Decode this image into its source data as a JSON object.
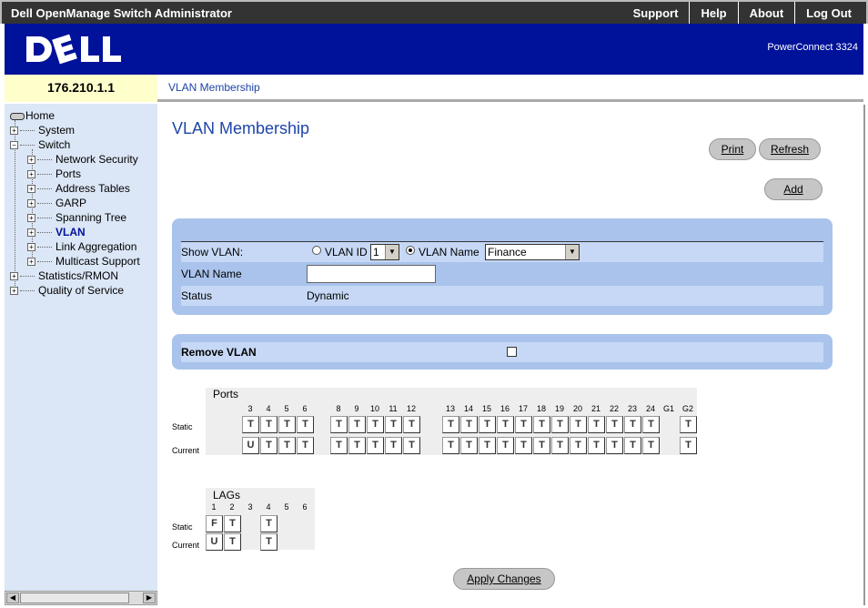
{
  "app": {
    "title": "Dell OpenManage Switch Administrator",
    "links": [
      "Support",
      "Help",
      "About",
      "Log Out"
    ],
    "model": "PowerConnect 3324",
    "ip": "176.210.1.1",
    "breadcrumb": "VLAN Membership"
  },
  "tree": {
    "home": "Home",
    "items": [
      {
        "label": "System",
        "level": 1
      },
      {
        "label": "Switch",
        "level": 1
      },
      {
        "label": "Network Security",
        "level": 2
      },
      {
        "label": "Ports",
        "level": 2
      },
      {
        "label": "Address Tables",
        "level": 2
      },
      {
        "label": "GARP",
        "level": 2
      },
      {
        "label": "Spanning Tree",
        "level": 2
      },
      {
        "label": "VLAN",
        "level": 2,
        "selected": true
      },
      {
        "label": "Link Aggregation",
        "level": 2
      },
      {
        "label": "Multicast Support",
        "level": 2
      },
      {
        "label": "Statistics/RMON",
        "level": 1
      },
      {
        "label": "Quality of Service",
        "level": 1
      }
    ]
  },
  "page": {
    "title": "VLAN Membership",
    "print_label": "Print",
    "refresh_label": "Refresh",
    "add_label": "Add",
    "apply_label": "Apply Changes"
  },
  "form": {
    "show_vlan_label": "Show VLAN:",
    "vlan_id_label": "VLAN ID",
    "vlan_id_value": "1",
    "vlan_name_radio_label": "VLAN Name",
    "vlan_name_select_value": "Finance",
    "vlan_name_label": "VLAN Name",
    "vlan_name_value": "",
    "status_label": "Status",
    "status_value": "Dynamic",
    "remove_vlan_label": "Remove VLAN",
    "remove_vlan_checked": false
  },
  "ports": {
    "title": "Ports",
    "static_label": "Static",
    "current_label": "Current",
    "numbers": [
      "3",
      "4",
      "5",
      "6",
      "8",
      "9",
      "10",
      "11",
      "12",
      "13",
      "14",
      "15",
      "16",
      "17",
      "18",
      "19",
      "20",
      "21",
      "22",
      "23",
      "24",
      "G1",
      "G2"
    ],
    "static": [
      "T",
      "T",
      "T",
      "T",
      "T",
      "T",
      "T",
      "T",
      "T",
      "T",
      "T",
      "T",
      "T",
      "T",
      "T",
      "T",
      "T",
      "T",
      "T",
      "T",
      "T",
      "",
      "T"
    ],
    "current": [
      "U",
      "T",
      "T",
      "T",
      "T",
      "T",
      "T",
      "T",
      "T",
      "T",
      "T",
      "T",
      "T",
      "T",
      "T",
      "T",
      "T",
      "T",
      "T",
      "T",
      "T",
      "",
      "T"
    ]
  },
  "lags": {
    "title": "LAGs",
    "static_label": "Static",
    "current_label": "Current",
    "numbers": [
      "1",
      "2",
      "3",
      "4",
      "5",
      "6"
    ],
    "static": [
      "F",
      "T",
      "",
      "T",
      "",
      ""
    ],
    "current": [
      "U",
      "T",
      "",
      "T",
      "",
      ""
    ]
  },
  "colors": {
    "banner": "#00129a",
    "panel": "#a9c3ec",
    "sidebar": "#dbe6f6",
    "link": "#1d45a8"
  }
}
